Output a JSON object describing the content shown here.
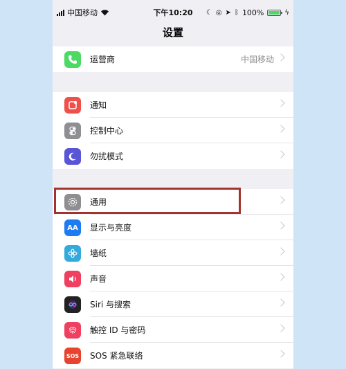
{
  "status_bar": {
    "carrier": "中国移动",
    "time": "下午10:20",
    "battery_percent": "100%",
    "battery_level": 1.0
  },
  "nav": {
    "title": "设置"
  },
  "groups": [
    {
      "rows": [
        {
          "label": "运营商",
          "value": "中国移动",
          "icon": "phone-icon",
          "color": "#4cd964"
        }
      ]
    },
    {
      "rows": [
        {
          "label": "通知",
          "icon": "notifications-icon",
          "color": "#f0504a"
        },
        {
          "label": "控制中心",
          "icon": "control-center-icon",
          "color": "#8e8e93"
        },
        {
          "label": "勿扰模式",
          "icon": "moon-icon",
          "color": "#5856d6"
        }
      ]
    },
    {
      "rows": [
        {
          "label": "通用",
          "icon": "gear-icon",
          "color": "#8e8e93"
        },
        {
          "label": "显示与亮度",
          "icon": "display-icon",
          "color": "#1e7cf2",
          "icon_text": "AA"
        },
        {
          "label": "墙纸",
          "icon": "wallpaper-icon",
          "color": "#34aadc"
        },
        {
          "label": "声音",
          "icon": "sound-icon",
          "color": "#f0405f"
        },
        {
          "label": "Siri 与搜索",
          "icon": "siri-icon",
          "color": "#222222"
        },
        {
          "label": "触控 ID 与密码",
          "icon": "fingerprint-icon",
          "color": "#f0405f"
        },
        {
          "label": "SOS 紧急联络",
          "icon": "sos-icon",
          "color": "#e8432f",
          "icon_text": "SOS"
        }
      ]
    }
  ]
}
